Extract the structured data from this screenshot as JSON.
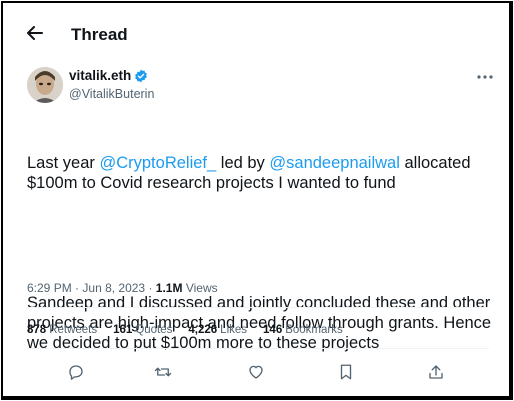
{
  "header": {
    "title": "Thread",
    "back_icon": "arrow-left-icon"
  },
  "author": {
    "display_name": "vitalik.eth",
    "handle": "@VitalikButerin",
    "verified_color": "#1d9bf0"
  },
  "tweet": {
    "p1_a": "Last year ",
    "mention1": "@CryptoRelief_",
    "p1_b": " led by ",
    "mention2": "@sandeepnailwal",
    "p1_c": " allocated $100m to Covid research projects I wanted to fund",
    "p2": "Sandeep and I discussed and jointly concluded these and other projects are high-impact and need follow through grants. Hence we decided to put $100m more to these projects"
  },
  "meta": {
    "time": "6:29 PM",
    "date": "Jun 8, 2023",
    "views_count": "1.1M",
    "views_label": "Views",
    "separator": "·"
  },
  "stats": {
    "retweets_count": "878",
    "retweets_label": "Retweets",
    "quotes_count": "161",
    "quotes_label": "Quotes",
    "likes_count": "4,226",
    "likes_label": "Likes",
    "bookmarks_count": "146",
    "bookmarks_label": "Bookmarks"
  },
  "colors": {
    "accent": "#1d9bf0",
    "text": "#0f1419",
    "secondary": "#536471"
  }
}
